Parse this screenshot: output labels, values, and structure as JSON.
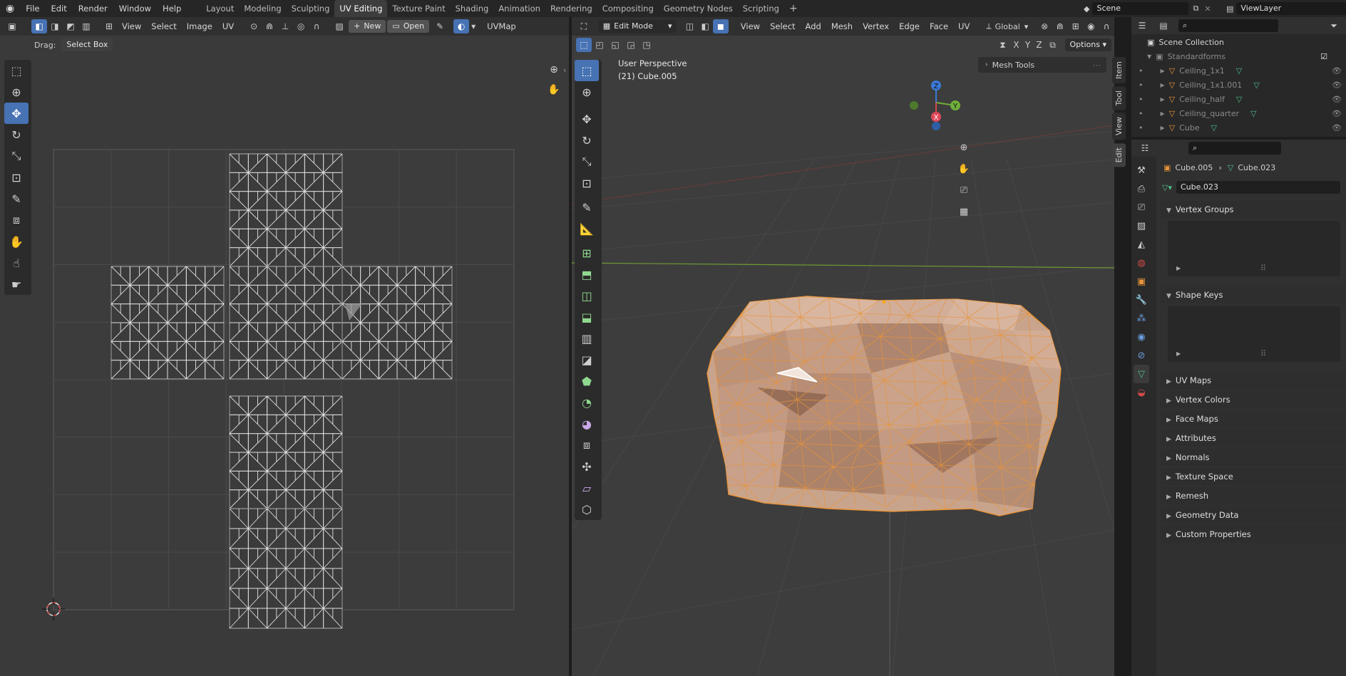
{
  "topbar": {
    "menus": [
      "File",
      "Edit",
      "Render",
      "Window",
      "Help"
    ],
    "workspaces": [
      "Layout",
      "Modeling",
      "Sculpting",
      "UV Editing",
      "Texture Paint",
      "Shading",
      "Animation",
      "Rendering",
      "Compositing",
      "Geometry Nodes",
      "Scripting"
    ],
    "active_workspace": "UV Editing",
    "add_tab": "+",
    "scene": "Scene",
    "view_layer": "ViewLayer"
  },
  "uv_editor": {
    "menus": [
      "View",
      "Select",
      "Image",
      "UV"
    ],
    "new_label": "New",
    "open_label": "Open",
    "uvmap_label": "UVMap",
    "drag_label": "Drag:",
    "drag_value": "Select Box"
  },
  "viewport": {
    "mode": "Edit Mode",
    "menus": [
      "View",
      "Select",
      "Add",
      "Mesh",
      "Vertex",
      "Edge",
      "Face",
      "UV"
    ],
    "orientation": "Global",
    "axes": [
      "X",
      "Y",
      "Z"
    ],
    "options_label": "Options",
    "perspective": "User Perspective",
    "object_info": "(21) Cube.005",
    "mesh_tools": "Mesh Tools",
    "side_tabs": [
      "Item",
      "Tool",
      "View",
      "Edit"
    ],
    "gizmo": {
      "z": "Z",
      "y": "Y",
      "x": "X"
    }
  },
  "outliner": {
    "scene_collection": "Scene Collection",
    "collection": "Standardforms",
    "items": [
      "Ceiling_1x1",
      "Ceiling_1x1.001",
      "Ceiling_half",
      "Ceiling_quarter",
      "Cube"
    ]
  },
  "properties": {
    "breadcrumb_object": "Cube.005",
    "breadcrumb_mesh": "Cube.023",
    "mesh_name": "Cube.023",
    "panels_open": [
      "Vertex Groups",
      "Shape Keys"
    ],
    "panels": [
      "UV Maps",
      "Vertex Colors",
      "Face Maps",
      "Attributes",
      "Normals",
      "Texture Space",
      "Remesh",
      "Geometry Data",
      "Custom Properties"
    ]
  },
  "colors": {
    "accent": "#4772b3",
    "selection_orange": "#e8943a",
    "mesh_fill": "#c9a48c"
  }
}
